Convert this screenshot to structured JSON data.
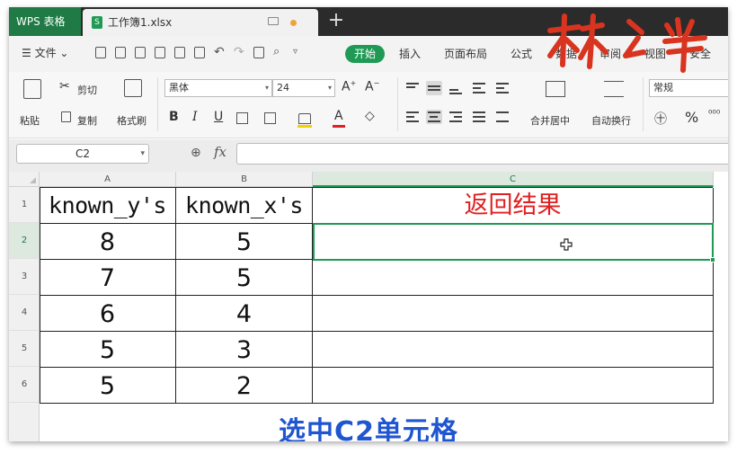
{
  "titlebar": {
    "app_name": "WPS 表格",
    "doc_name": "工作簿1.xlsx",
    "new_tab": "+"
  },
  "menu": {
    "file": "☰ 文件 ⌄",
    "start": "开始",
    "tabs": [
      "插入",
      "页面布局",
      "公式",
      "数据",
      "审阅",
      "视图",
      "安全"
    ]
  },
  "ribbon": {
    "paste": "粘贴",
    "cut": "剪切",
    "copy": "复制",
    "format_painter": "格式刷",
    "font_name": "黑体",
    "font_size": "24",
    "merge_center": "合并居中",
    "wrap_text": "自动换行",
    "number_format": "常规"
  },
  "formula_bar": {
    "name_box": "C2",
    "fx": "fx"
  },
  "sheet": {
    "columns": [
      "A",
      "B",
      "C"
    ],
    "rows": [
      "1",
      "2",
      "3",
      "4",
      "5",
      "6"
    ],
    "header": [
      "known_y's",
      "known_x's",
      "返回结果"
    ],
    "data": [
      [
        "8",
        "5"
      ],
      [
        "7",
        "5"
      ],
      [
        "6",
        "4"
      ],
      [
        "5",
        "3"
      ],
      [
        "5",
        "2"
      ]
    ],
    "selected_cell": "C2"
  },
  "caption": "选中C2单元格",
  "colors": {
    "brand_green": "#1f9a55",
    "result_red": "#e02020",
    "caption_blue": "#1f55d0"
  }
}
